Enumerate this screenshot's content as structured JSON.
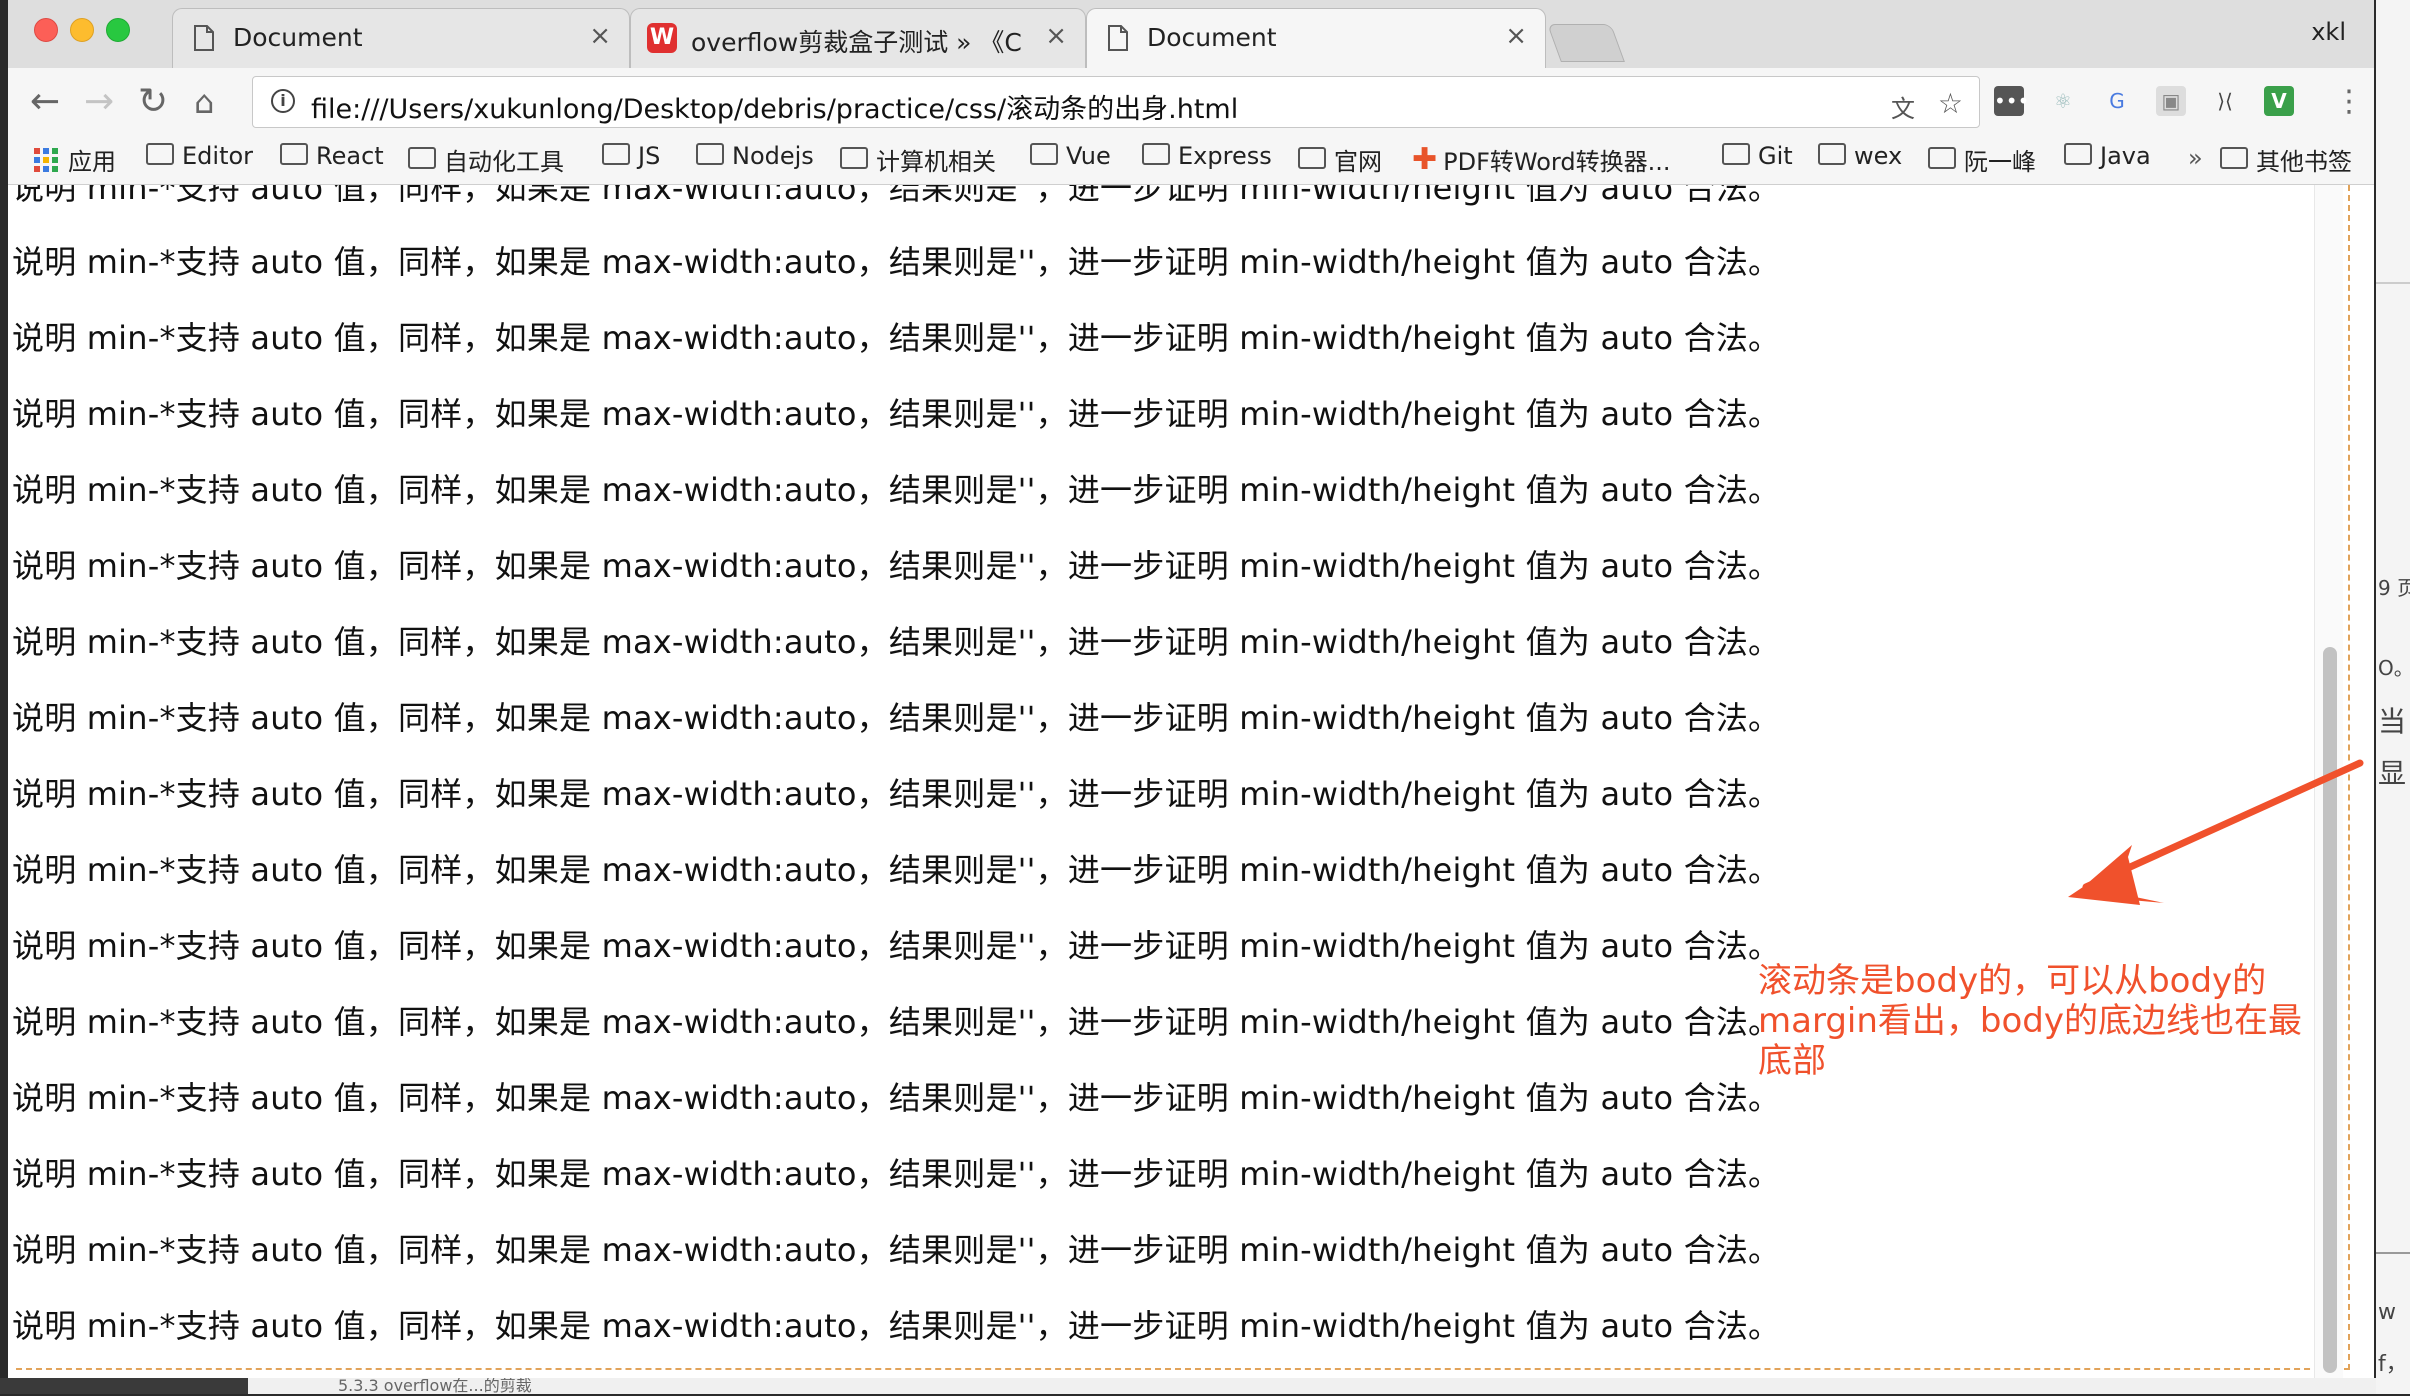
{
  "tabs": [
    {
      "title": "Document",
      "icon": "page-icon",
      "active": false
    },
    {
      "title": "overflow剪裁盒子测试 » 《CSS",
      "icon": "w-favicon",
      "active": false
    },
    {
      "title": "Document",
      "icon": "page-icon",
      "active": true
    }
  ],
  "profile": "xkl",
  "toolbar": {
    "url": "file:///Users/xukunlong/Desktop/debris/practice/css/滚动条的出身.html"
  },
  "bookmarks": [
    {
      "label": "应用",
      "icon": "apps-grid-icon"
    },
    {
      "label": "Editor",
      "icon": "folder-icon"
    },
    {
      "label": "React",
      "icon": "folder-icon"
    },
    {
      "label": "自动化工具",
      "icon": "folder-icon"
    },
    {
      "label": "JS",
      "icon": "folder-icon"
    },
    {
      "label": "Nodejs",
      "icon": "folder-icon"
    },
    {
      "label": "计算机相关",
      "icon": "folder-icon"
    },
    {
      "label": "Vue",
      "icon": "folder-icon"
    },
    {
      "label": "Express",
      "icon": "folder-icon"
    },
    {
      "label": "官网",
      "icon": "folder-icon"
    },
    {
      "label": "PDF转Word转换器...",
      "icon": "pdf-plus-icon"
    },
    {
      "label": "Git",
      "icon": "folder-icon"
    },
    {
      "label": "wex",
      "icon": "folder-icon"
    },
    {
      "label": "阮一峰",
      "icon": "folder-icon"
    },
    {
      "label": "Java",
      "icon": "folder-icon"
    },
    {
      "label": "其他书签",
      "icon": "folder-icon"
    }
  ],
  "bookmarks_overflow": "»",
  "content": {
    "partial_line": "说明 min-*支持 auto 值，同样，如果是 max-width:auto，结果则是''，进一步证明 min-width/height 值为 auto 合法。",
    "lines": [
      "说明 min-*支持 auto 值，同样，如果是 max-width:auto，结果则是''，进一步证明 min-width/height 值为 auto 合法。",
      "说明 min-*支持 auto 值，同样，如果是 max-width:auto，结果则是''，进一步证明 min-width/height 值为 auto 合法。",
      "说明 min-*支持 auto 值，同样，如果是 max-width:auto，结果则是''，进一步证明 min-width/height 值为 auto 合法。",
      "说明 min-*支持 auto 值，同样，如果是 max-width:auto，结果则是''，进一步证明 min-width/height 值为 auto 合法。",
      "说明 min-*支持 auto 值，同样，如果是 max-width:auto，结果则是''，进一步证明 min-width/height 值为 auto 合法。",
      "说明 min-*支持 auto 值，同样，如果是 max-width:auto，结果则是''，进一步证明 min-width/height 值为 auto 合法。",
      "说明 min-*支持 auto 值，同样，如果是 max-width:auto，结果则是''，进一步证明 min-width/height 值为 auto 合法。",
      "说明 min-*支持 auto 值，同样，如果是 max-width:auto，结果则是''，进一步证明 min-width/height 值为 auto 合法。",
      "说明 min-*支持 auto 值，同样，如果是 max-width:auto，结果则是''，进一步证明 min-width/height 值为 auto 合法。",
      "说明 min-*支持 auto 值，同样，如果是 max-width:auto，结果则是''，进一步证明 min-width/height 值为 auto 合法。",
      "说明 min-*支持 auto 值，同样，如果是 max-width:auto，结果则是''，进一步证明 min-width/height 值为 auto 合法。",
      "说明 min-*支持 auto 值，同样，如果是 max-width:auto，结果则是''，进一步证明 min-width/height 值为 auto 合法。",
      "说明 min-*支持 auto 值，同样，如果是 max-width:auto，结果则是''，进一步证明 min-width/height 值为 auto 合法。",
      "说明 min-*支持 auto 值，同样，如果是 max-width:auto，结果则是''，进一步证明 min-width/height 值为 auto 合法。",
      "说明 min-*支持 auto 值，同样，如果是 max-width:auto，结果则是''，进一步证明 min-width/height 值为 auto 合法。"
    ]
  },
  "annotation": {
    "text": "滚动条是body的，可以从body的margin看出，body的底边线也在最底部",
    "color": "#f0512c"
  },
  "colors": {
    "body_outline": "#e2a35a",
    "scroll_thumb": "#c2c2c2"
  },
  "background_app": {
    "fragments": [
      "9 页",
      "O。",
      "当",
      "显",
      "w",
      "f，"
    ],
    "bottom_text": "5.3.3 overflow在...的剪裁"
  }
}
